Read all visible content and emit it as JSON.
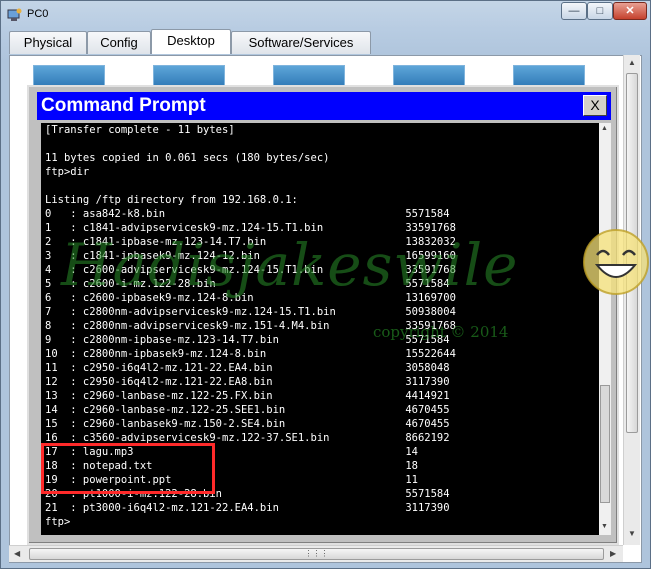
{
  "window": {
    "title": "PC0",
    "minimize_icon": "minimize-icon",
    "maximize_icon": "maximize-icon",
    "close_icon": "close-icon"
  },
  "tabs": [
    {
      "label": "Physical"
    },
    {
      "label": "Config"
    },
    {
      "label": "Desktop",
      "active": true
    },
    {
      "label": "Software/Services"
    }
  ],
  "cmd": {
    "title": "Command Prompt",
    "close_label": "X",
    "lines": [
      "[Transfer complete - 11 bytes]",
      "",
      "11 bytes copied in 0.061 secs (180 bytes/sec)",
      "ftp>dir",
      "",
      "Listing /ftp directory from 192.168.0.1:",
      "0   : asa842-k8.bin                                      5571584",
      "1   : c1841-advipservicesk9-mz.124-15.T1.bin             33591768",
      "2   : c1841-ipbase-mz.123-14.T7.bin                      13832032",
      "3   : c1841-ipbasek9-mz.124-12.bin                       16599160",
      "4   : c2600-advipservicesk9-mz.124-15.T1.bin             33591768",
      "5   : c2600-i-mz.122-28.bin                              5571584",
      "6   : c2600-ipbasek9-mz.124-8.bin                        13169700",
      "7   : c2800nm-advipservicesk9-mz.124-15.T1.bin           50938004",
      "8   : c2800nm-advipservicesk9-mz.151-4.M4.bin            33591768",
      "9   : c2800nm-ipbase-mz.123-14.T7.bin                    5571584",
      "10  : c2800nm-ipbasek9-mz.124-8.bin                      15522644",
      "11  : c2950-i6q4l2-mz.121-22.EA4.bin                     3058048",
      "12  : c2950-i6q4l2-mz.121-22.EA8.bin                     3117390",
      "13  : c2960-lanbase-mz.122-25.FX.bin                     4414921",
      "14  : c2960-lanbase-mz.122-25.SEE1.bin                   4670455",
      "15  : c2960-lanbasek9-mz.150-2.SE4.bin                   4670455",
      "16  : c3560-advipservicesk9-mz.122-37.SE1.bin            8662192",
      "17  : lagu.mp3                                           14",
      "18  : notepad.txt                                        18",
      "19  : powerpoint.ppt                                     11",
      "20  : pt1000-i-mz.122-28.bin                             5571584",
      "21  : pt3000-i6q4l2-mz.121-22.EA4.bin                    3117390",
      "ftp>"
    ]
  },
  "watermark": {
    "text": "Hadisjakeswile",
    "copyright": "copyright © 2014"
  },
  "colors": {
    "cmd_title_bg": "#0000ff",
    "highlight": "#ff2a2a"
  }
}
